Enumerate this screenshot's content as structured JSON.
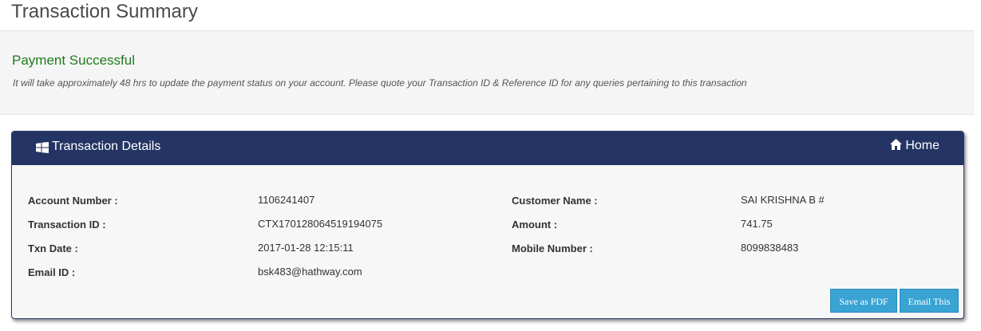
{
  "page": {
    "title": "Transaction Summary"
  },
  "notice": {
    "title": "Payment Successful",
    "message": "It will take approximately 48 hrs to update the payment status on your account. Please quote your Transaction ID & Reference ID for any queries pertaining to this transaction"
  },
  "panel": {
    "title": "Transaction Details",
    "home_label": "Home",
    "header_color": "#243464"
  },
  "details": {
    "account_number_label": "Account Number :",
    "account_number": "1106241407",
    "transaction_id_label": "Transaction ID :",
    "transaction_id": "CTX170128064519194075",
    "txn_date_label": "Txn Date :",
    "txn_date": "2017-01-28 12:15:11",
    "email_id_label": "Email ID :",
    "email_id": "bsk483@hathway.com",
    "customer_name_label": "Customer Name :",
    "customer_name": "SAI KRISHNA B #",
    "amount_label": "Amount :",
    "amount": "741.75",
    "mobile_number_label": "Mobile Number :",
    "mobile_number": "8099838483"
  },
  "actions": {
    "save_pdf_label": "Save as PDF",
    "email_label": "Email This",
    "button_color": "#39a3d3"
  },
  "icons": {
    "header_icon": "windows-icon",
    "home_icon": "home-icon"
  }
}
